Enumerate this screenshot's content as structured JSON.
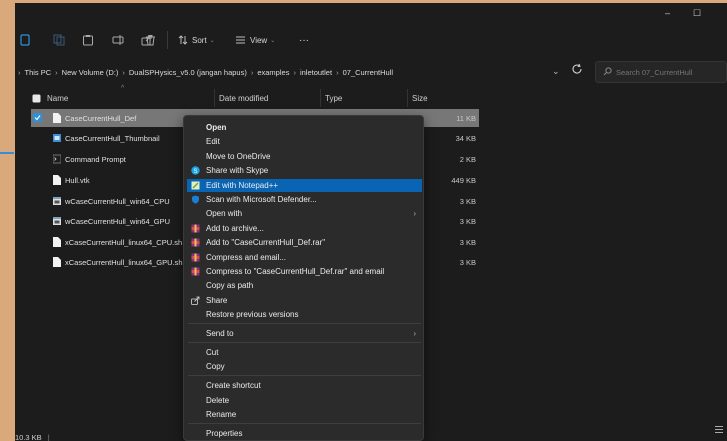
{
  "window": {
    "minimize_glyph": "–",
    "maximize_glyph": "☐"
  },
  "toolbar": {
    "sort_label": "Sort",
    "view_label": "View",
    "more_label": "···"
  },
  "address": {
    "crumbs": [
      "This PC",
      "New Volume (D:)",
      "DualSPHysics_v5.0 (jangan hapus)",
      "examples",
      "inletoutlet",
      "07_CurrentHull"
    ],
    "search_placeholder": "Search 07_CurrentHull"
  },
  "columns": {
    "name": "Name",
    "date": "Date modified",
    "type": "Type",
    "size": "Size"
  },
  "files": [
    {
      "name": "CaseCurrentHull_Def",
      "size": "11 KB",
      "icon": "doc-icon"
    },
    {
      "name": "CaseCurrentHull_Thumbnail",
      "size": "34 KB",
      "icon": "image-icon"
    },
    {
      "name": "Command Prompt",
      "size": "2 KB",
      "icon": "shortcut-icon"
    },
    {
      "name": "Hull.vtk",
      "size": "449 KB",
      "icon": "doc-icon"
    },
    {
      "name": "wCaseCurrentHull_win64_CPU",
      "size": "3 KB",
      "icon": "batch-icon"
    },
    {
      "name": "wCaseCurrentHull_win64_GPU",
      "size": "3 KB",
      "icon": "batch-icon"
    },
    {
      "name": "xCaseCurrentHull_linux64_CPU.sh",
      "size": "3 KB",
      "icon": "doc-icon"
    },
    {
      "name": "xCaseCurrentHull_linux64_GPU.sh",
      "size": "3 KB",
      "icon": "doc-icon"
    }
  ],
  "status": {
    "size_text": "10.3 KB"
  },
  "context_menu": {
    "items": [
      {
        "label": "Open",
        "bold": true
      },
      {
        "label": "Edit"
      },
      {
        "label": "Move to OneDrive"
      },
      {
        "label": "Share with Skype",
        "icon": "skype-icon"
      },
      {
        "label": "Edit with Notepad++",
        "icon": "notepadpp-icon",
        "highlight": true
      },
      {
        "label": "Scan with Microsoft Defender...",
        "icon": "defender-icon"
      },
      {
        "label": "Open with",
        "submenu": true
      },
      {
        "label": "Add to archive...",
        "icon": "winrar-icon"
      },
      {
        "label": "Add to \"CaseCurrentHull_Def.rar\"",
        "icon": "winrar-icon"
      },
      {
        "label": "Compress and email...",
        "icon": "winrar-icon"
      },
      {
        "label": "Compress to \"CaseCurrentHull_Def.rar\" and email",
        "icon": "winrar-icon"
      },
      {
        "label": "Copy as path"
      },
      {
        "label": "Share",
        "icon": "share-icon"
      },
      {
        "label": "Restore previous versions"
      },
      {
        "label": "Send to",
        "submenu": true
      },
      {
        "label": "Cut"
      },
      {
        "label": "Copy"
      },
      {
        "label": "Create shortcut"
      },
      {
        "label": "Delete"
      },
      {
        "label": "Rename"
      },
      {
        "label": "Properties"
      }
    ]
  },
  "colors": {
    "accent": "#0a64b4",
    "selection": "#777777",
    "background": "#1c1c1c",
    "menu": "#2b2b2b"
  }
}
